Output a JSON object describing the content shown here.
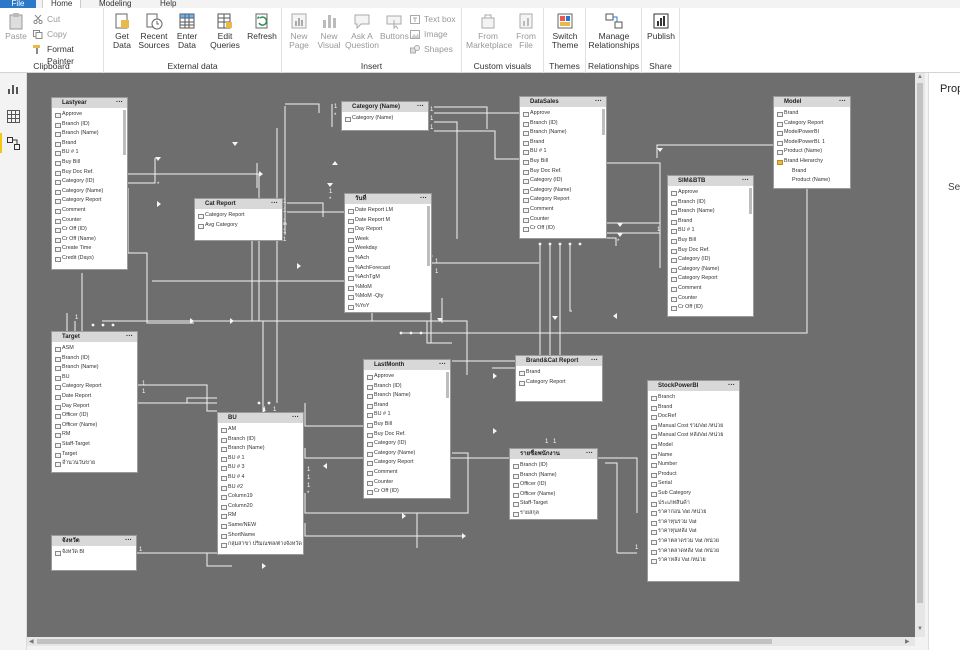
{
  "menu": {
    "file": "File",
    "tabs": [
      "Home",
      "Modeling",
      "Help"
    ]
  },
  "ribbon": {
    "clipboard": {
      "label": "Clipboard",
      "paste": "Paste",
      "cut": "Cut",
      "copy": "Copy",
      "format_painter": "Format Painter"
    },
    "external_data": {
      "label": "External data",
      "get_data": "Get Data",
      "recent_sources": "Recent Sources",
      "enter_data": "Enter Data",
      "edit_queries": "Edit Queries",
      "refresh": "Refresh"
    },
    "insert": {
      "label": "Insert",
      "new_page": "New Page",
      "new_visual": "New Visual",
      "ask_question": "Ask A Question",
      "buttons": "Buttons",
      "text_box": "Text box",
      "image": "Image",
      "shapes": "Shapes"
    },
    "custom_visuals": {
      "label": "Custom visuals",
      "from_marketplace": "From Marketplace",
      "from_file": "From File"
    },
    "themes": {
      "label": "Themes",
      "switch_theme": "Switch Theme"
    },
    "relationships": {
      "label": "Relationships",
      "manage": "Manage Relationships"
    },
    "share": {
      "label": "Share",
      "publish": "Publish"
    }
  },
  "right_pane": {
    "title": "Properties",
    "text": "Select an object"
  },
  "tables": [
    {
      "name": "Lastyear",
      "fields": [
        "Approve",
        "Branch (ID)",
        "Branch (Name)",
        "Brand",
        "BU # 1",
        "Buy Bill",
        "Buy Doc Ref.",
        "Category (ID)",
        "Category (Name)",
        "Category Report",
        "Comment",
        "Counter",
        "Cr Off (ID)",
        "Cr Off (Name)",
        "Create Time",
        "Credit (Days)"
      ]
    },
    {
      "name": "Category (Name)",
      "fields": [
        "Category (Name)"
      ]
    },
    {
      "name": "DataSales",
      "fields": [
        "Approve",
        "Branch (ID)",
        "Branch (Name)",
        "Brand",
        "BU # 1",
        "Buy Bill",
        "Buy Doc Ref.",
        "Category (ID)",
        "Category (Name)",
        "Category Report",
        "Comment",
        "Counter",
        "Cr Off (ID)"
      ]
    },
    {
      "name": "Model",
      "fields": [
        "Brand",
        "Category Report",
        "ModelPowerBI",
        "ModelPowerBI. 1",
        "Product (Name)",
        "Brand Hierarchy",
        "Brand",
        "Product (Name)"
      ]
    },
    {
      "name": "Cat Report",
      "fields": [
        "Category Report",
        "Avg Category"
      ]
    },
    {
      "name": "วันที่",
      "fields": [
        "Date Report LM",
        "Date Report M",
        "Day Report",
        "Week",
        "Weekday",
        "%Ach",
        "%AchForecast",
        "%AchTgM",
        "%MoM",
        "%MoM -Qty",
        "%YoY"
      ]
    },
    {
      "name": "SIM&BTB",
      "fields": [
        "Approve",
        "Branch (ID)",
        "Branch (Name)",
        "Brand",
        "BU # 1",
        "Buy Bill",
        "Buy Doc Ref.",
        "Category (ID)",
        "Category (Name)",
        "Category Report",
        "Comment",
        "Counter",
        "Cr Off (ID)"
      ]
    },
    {
      "name": "Target",
      "fields": [
        "ASM",
        "Branch (ID)",
        "Branch (Name)",
        "BU",
        "Category Report",
        "Date Report",
        "Day Report",
        "Officer (ID)",
        "Officer (Name)",
        "RM",
        "Staff-Target",
        "Target",
        "จำนวนวันขาย"
      ]
    },
    {
      "name": "LastMonth",
      "fields": [
        "Approve",
        "Branch (ID)",
        "Branch (Name)",
        "Brand",
        "BU # 1",
        "Buy Bill",
        "Buy Doc Ref.",
        "Category (ID)",
        "Category (Name)",
        "Category Report",
        "Comment",
        "Counter",
        "Cr Off (ID)"
      ]
    },
    {
      "name": "Brand&Cat Report",
      "fields": [
        "Brand",
        "Category Report"
      ]
    },
    {
      "name": "BU",
      "fields": [
        "AM",
        "Branch (ID)",
        "Branch (Name)",
        "BU # 1",
        "BU # 3",
        "BU # 4",
        "BU #2",
        "Column19",
        "Column20",
        "RM",
        "Same/NEW",
        "ShortName",
        "กลุ่มสาขา ปริมณฑล/ต่างจังหวัด"
      ]
    },
    {
      "name": "รายชื่อพนักงาน",
      "fields": [
        "Branch (ID)",
        "Branch (Name)",
        "Officer (ID)",
        "Officer (Name)",
        "Staff-Target",
        "รายสกุล"
      ]
    },
    {
      "name": "StockPowerBI",
      "fields": [
        "Branch",
        "Brand",
        "DocRef",
        "Manual Cost รวมVat /หน่วย",
        "Manual Cost หลังVat /หน่วย",
        "Model",
        "Name",
        "Number",
        "Product",
        "Serial",
        "Sub Category",
        "ประเภทสินค้า",
        "ราคาก่อน Vat /หน่วย",
        "ราคาทุนรวม Vat",
        "ราคาทุนหลัง Vat",
        "ราคาตลาดรวม Vat /หน่วย",
        "ราคาตลาดหลัง Vat /หน่วย",
        "ราคาหลัง Vat /หน่วย"
      ]
    },
    {
      "name": "จังหวัด",
      "fields": [
        "จังหวัด BI"
      ]
    }
  ],
  "relationship_labels": {
    "one": "1",
    "many": "*"
  },
  "colors": {
    "accent": "#2b78c8",
    "canvas": "#6e6e6e",
    "header": "#d8d8d8"
  }
}
